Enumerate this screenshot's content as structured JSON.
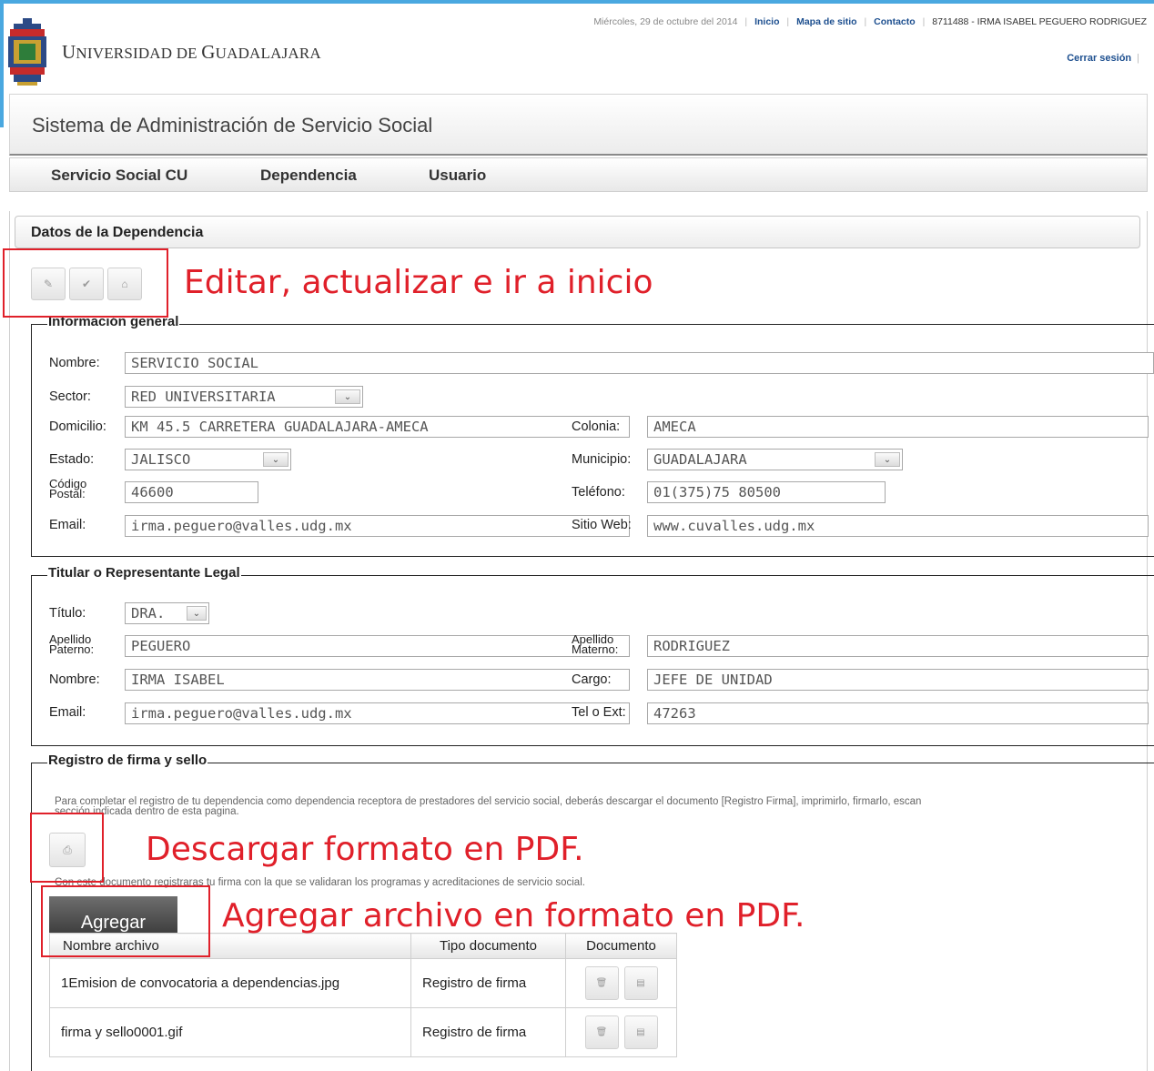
{
  "header": {
    "date": "Miércoles, 29 de octubre del 2014",
    "links": [
      "Inicio",
      "Mapa de sitio",
      "Contacto"
    ],
    "user": "8711488 - IRMA ISABEL PEGUERO RODRIGUEZ",
    "logout": "Cerrar sesión",
    "university_initial_u": "U",
    "university_rest_1": "NIVERSIDAD DE ",
    "university_initial_g": "G",
    "university_rest_2": "UADALAJARA"
  },
  "system_title": "Sistema de Administración de Servicio Social",
  "nav": [
    "Servicio Social CU",
    "Dependencia",
    "Usuario"
  ],
  "panel_title": "Datos de la Dependencia",
  "toolbar": {
    "edit_icon": "pencil-icon",
    "update_icon": "check-icon",
    "home_icon": "home-icon"
  },
  "general": {
    "legend": "Información general",
    "nombre_label": "Nombre:",
    "nombre": "SERVICIO SOCIAL",
    "sector_label": "Sector:",
    "sector": "RED UNIVERSITARIA",
    "domicilio_label": "Domicilio:",
    "domicilio": "KM 45.5 CARRETERA GUADALAJARA-AMECA",
    "colonia_label": "Colonia:",
    "colonia": "AMECA",
    "estado_label": "Estado:",
    "estado": "JALISCO",
    "municipio_label": "Municipio:",
    "municipio": "GUADALAJARA",
    "cp_label_1": "Código",
    "cp_label_2": "Postal:",
    "cp": "46600",
    "telefono_label": "Teléfono:",
    "telefono": "01(375)75 80500",
    "email_label": "Email:",
    "email": "irma.peguero@valles.udg.mx",
    "web_label": "Sitio Web:",
    "web": "www.cuvalles.udg.mx"
  },
  "titular": {
    "legend": "Titular o Representante Legal",
    "titulo_label": "Título:",
    "titulo": "DRA.",
    "ap_label_1": "Apellido",
    "ap_label_2": "Paterno:",
    "apellido_paterno": "PEGUERO",
    "am_label_1": "Apellido",
    "am_label_2": "Materno:",
    "apellido_materno": "RODRIGUEZ",
    "nombre_label": "Nombre:",
    "nombre": "IRMA ISABEL",
    "cargo_label": "Cargo:",
    "cargo": "JEFE DE UNIDAD",
    "email_label": "Email:",
    "email": "irma.peguero@valles.udg.mx",
    "tel_label": "Tel o Ext:",
    "tel": "47263"
  },
  "firma": {
    "legend": "Registro de firma y sello",
    "instructions_1": "Para completar el registro de tu dependencia como dependencia receptora de prestadores del servicio social, deberás descargar el documento [Registro Firma], imprimirlo, firmarlo, escan",
    "instructions_2": "sección indicada dentro de esta pagina.",
    "note": "Con este documento registraras tu firma con la que se validaran los programas y acreditaciones de servicio social.",
    "add_button": "Agregar",
    "table": {
      "headers": [
        "Nombre archivo",
        "Tipo documento",
        "Documento"
      ],
      "rows": [
        {
          "nombre": "1Emision de convocatoria a dependencias.jpg",
          "tipo": "Registro de firma"
        },
        {
          "nombre": "firma y sello0001.gif",
          "tipo": "Registro de firma"
        }
      ]
    }
  },
  "annotations": {
    "toolbar": "Editar, actualizar e ir a inicio",
    "download": "Descargar formato en PDF.",
    "add": "Agregar archivo en formato en PDF."
  },
  "colors": {
    "annotation": "#e0202a",
    "link": "#1d4f8f",
    "accent_bar": "#4aa8e0"
  }
}
